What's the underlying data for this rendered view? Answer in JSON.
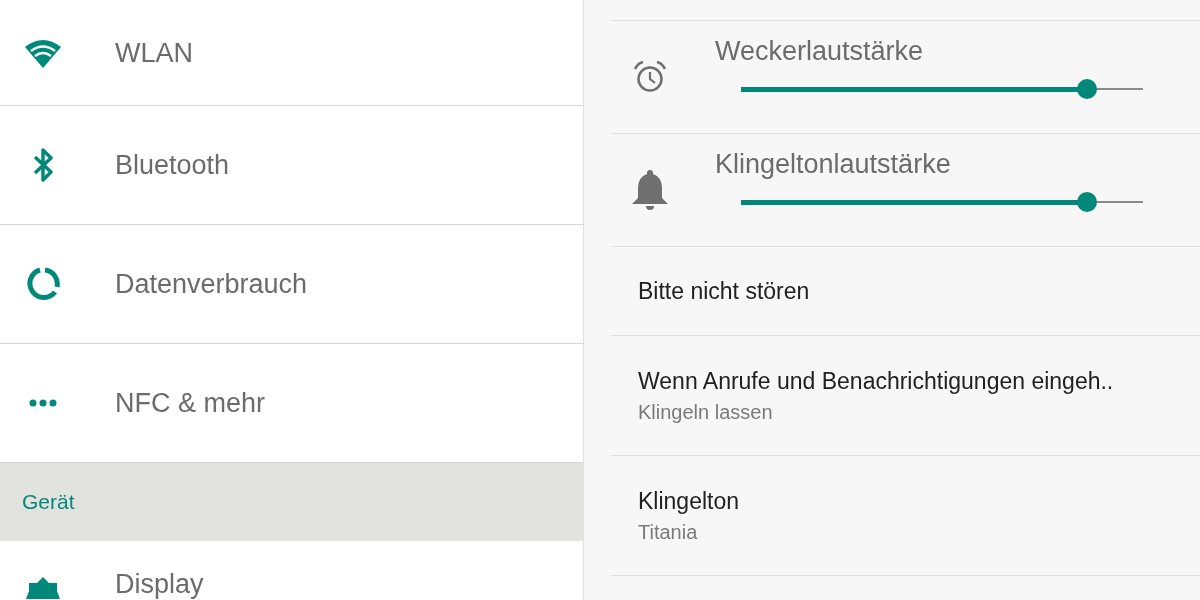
{
  "settings_list": [
    {
      "kind": "item",
      "label": "WLAN"
    },
    {
      "kind": "item",
      "label": "Bluetooth"
    },
    {
      "kind": "item",
      "label": "Datenverbrauch"
    },
    {
      "kind": "item",
      "label": "NFC & mehr"
    },
    {
      "kind": "header",
      "label": "Gerät"
    },
    {
      "kind": "item",
      "label": "Display"
    }
  ],
  "sound_panel": [
    {
      "kind": "slider",
      "label": "Weckerlautstärke",
      "level": 0.86
    },
    {
      "kind": "slider",
      "label": "Klingeltonlautstärke",
      "level": 0.86
    },
    {
      "kind": "entry",
      "title": "Bitte nicht stören"
    },
    {
      "kind": "entry",
      "title": "Wenn Anrufe und Benachrichtigungen eingeh..",
      "subtitle": "Klingeln lassen"
    },
    {
      "kind": "entry",
      "title": "Klingelton",
      "subtitle": "Titania"
    }
  ]
}
